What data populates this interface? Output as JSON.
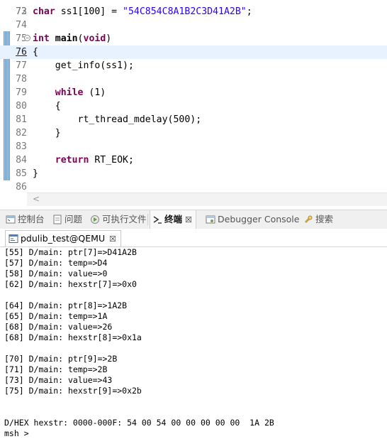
{
  "editor": {
    "top_partial_line_number": "72",
    "lines": [
      {
        "n": "73",
        "tokens": [
          {
            "t": "kw",
            "v": "char"
          },
          {
            "t": "plain",
            "v": " ss1[100] = "
          },
          {
            "t": "str",
            "v": "\"54C854C8A1B2C3D41A2B\""
          },
          {
            "t": "plain",
            "v": ";"
          }
        ]
      },
      {
        "n": "74",
        "tokens": []
      },
      {
        "n": "75",
        "tokens": [
          {
            "t": "kw",
            "v": "int"
          },
          {
            "t": "plain",
            "v": " "
          },
          {
            "t": "bold",
            "v": "main"
          },
          {
            "t": "plain",
            "v": "("
          },
          {
            "t": "kw",
            "v": "void"
          },
          {
            "t": "plain",
            "v": ")"
          }
        ]
      },
      {
        "n": "76",
        "tokens": [
          {
            "t": "plain",
            "v": "{"
          }
        ]
      },
      {
        "n": "77",
        "tokens": [
          {
            "t": "plain",
            "v": "    get_info(ss1);"
          }
        ]
      },
      {
        "n": "78",
        "tokens": []
      },
      {
        "n": "79",
        "tokens": [
          {
            "t": "plain",
            "v": "    "
          },
          {
            "t": "kw",
            "v": "while"
          },
          {
            "t": "plain",
            "v": " (1)"
          }
        ]
      },
      {
        "n": "80",
        "tokens": [
          {
            "t": "plain",
            "v": "    {"
          }
        ]
      },
      {
        "n": "81",
        "tokens": [
          {
            "t": "plain",
            "v": "        rt_thread_mdelay(500);"
          }
        ]
      },
      {
        "n": "82",
        "tokens": [
          {
            "t": "plain",
            "v": "    }"
          }
        ]
      },
      {
        "n": "83",
        "tokens": []
      },
      {
        "n": "84",
        "tokens": [
          {
            "t": "plain",
            "v": "    "
          },
          {
            "t": "kw",
            "v": "return"
          },
          {
            "t": "plain",
            "v": " RT_EOK;"
          }
        ]
      },
      {
        "n": "85",
        "tokens": [
          {
            "t": "plain",
            "v": "}"
          }
        ]
      },
      {
        "n": "86",
        "tokens": []
      }
    ],
    "current_line": "76",
    "fold_marker_line": "75",
    "scroll_left_arrow": "<"
  },
  "views": {
    "tabs": [
      {
        "label": "控制台",
        "icon": "console-icon",
        "active": false
      },
      {
        "label": "问题",
        "icon": "problems-icon",
        "active": false
      },
      {
        "label": "可执行文件",
        "icon": "executables-icon",
        "active": false
      },
      {
        "label": "终端",
        "icon": "terminal-icon",
        "active": true,
        "close": "☒"
      },
      {
        "label": "Debugger Console",
        "icon": "debugger-console-icon",
        "active": false
      },
      {
        "label": "搜索",
        "icon": "search-icon",
        "active": false
      }
    ]
  },
  "console": {
    "tab_label": "pdulib_test@QEMU",
    "tab_close": "☒",
    "lines": [
      "[55] D/main: ptr[7]=>D41A2B",
      "[57] D/main: temp=>D4",
      "[58] D/main: value=>0",
      "[62] D/main: hexstr[7]=>0x0",
      "",
      "[64] D/main: ptr[8]=>1A2B",
      "[65] D/main: temp=>1A",
      "[68] D/main: value=>26",
      "[68] D/main: hexstr[8]=>0x1a",
      "",
      "[70] D/main: ptr[9]=>2B",
      "[71] D/main: temp=>2B",
      "[73] D/main: value=>43",
      "[75] D/main: hexstr[9]=>0x2b",
      "",
      "",
      "D/HEX hexstr: 0000-000F: 54 00 54 00 00 00 00 00  1A 2B",
      "msh >"
    ]
  },
  "colors": {
    "keyword": "#7f0055",
    "string": "#2a00ff",
    "current_line_bg": "#e8f2fe",
    "line_number": "#787878"
  }
}
